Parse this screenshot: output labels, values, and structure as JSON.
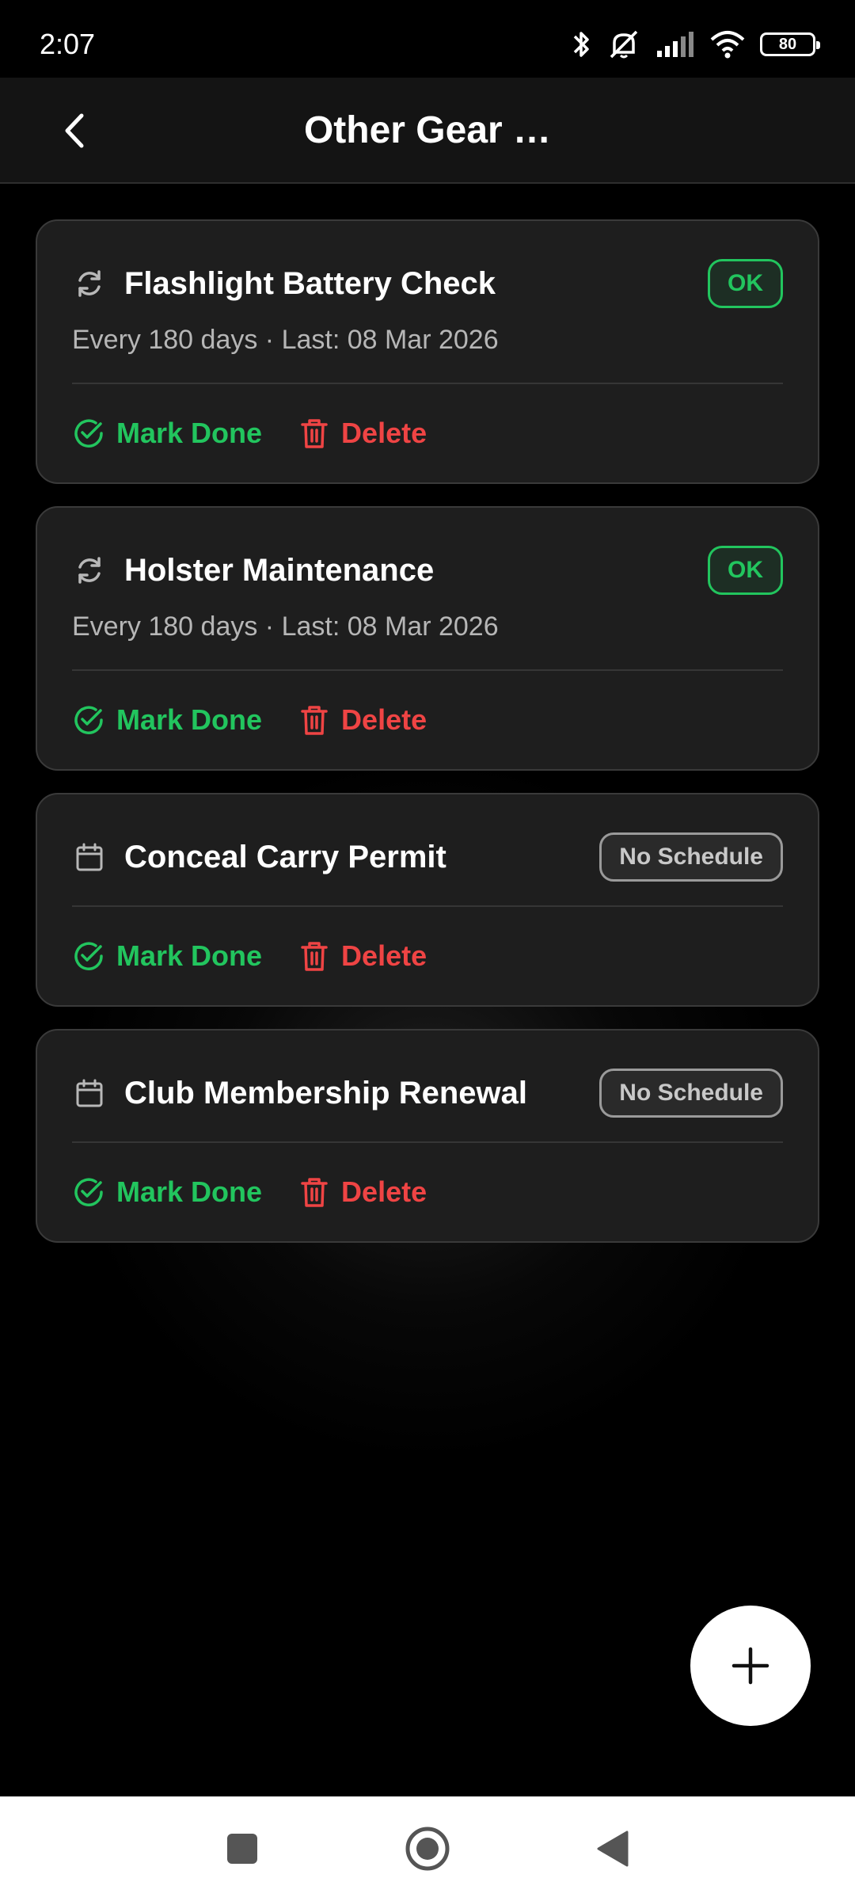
{
  "status_bar": {
    "time": "2:07",
    "battery": "80"
  },
  "app_bar": {
    "title": "Other Gear …"
  },
  "items": [
    {
      "title": "Flashlight Battery Check",
      "icon": "refresh-icon",
      "subtitle": "Every 180 days · Last: 08 Mar 2026",
      "badge": "OK",
      "badge_type": "ok",
      "done_label": "Mark Done",
      "delete_label": "Delete"
    },
    {
      "title": "Holster Maintenance",
      "icon": "refresh-icon",
      "subtitle": "Every 180 days · Last: 08 Mar 2026",
      "badge": "OK",
      "badge_type": "ok",
      "done_label": "Mark Done",
      "delete_label": "Delete"
    },
    {
      "title": "Conceal Carry Permit",
      "icon": "calendar-icon",
      "subtitle": "",
      "badge": "No Schedule",
      "badge_type": "none",
      "done_label": "Mark Done",
      "delete_label": "Delete"
    },
    {
      "title": "Club Membership Renewal",
      "icon": "calendar-icon",
      "subtitle": "",
      "badge": "No Schedule",
      "badge_type": "none",
      "done_label": "Mark Done",
      "delete_label": "Delete"
    }
  ],
  "colors": {
    "ok": "#22c55e",
    "danger": "#ef4444",
    "card_bg": "#1e1e1e"
  },
  "fab": {
    "icon": "plus-icon"
  }
}
